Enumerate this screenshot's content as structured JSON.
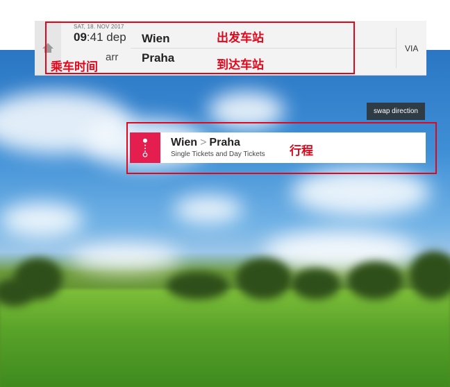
{
  "header": {
    "date": "SAT, 18. NOV 2017",
    "dep_hour": "09",
    "dep_min": ":41",
    "dep_label": "dep",
    "arr_label": "arr",
    "from_station": "Wien",
    "to_station": "Praha",
    "via_label": "VIA"
  },
  "annotations": {
    "departure_station": "出发车站",
    "arrival_station": "到达车站",
    "ride_time": "乘车时间",
    "itinerary": "行程"
  },
  "swap": {
    "label": "swap direction"
  },
  "route": {
    "from": "Wien",
    "separator": ">",
    "to": "Praha",
    "subtitle": "Single Tickets and Day Tickets"
  },
  "colors": {
    "accent": "#e41e4f",
    "annotation": "#e1061a",
    "swap_bg": "#2f3b45"
  },
  "icons": {
    "home": "home-icon",
    "route": "route-icon"
  }
}
